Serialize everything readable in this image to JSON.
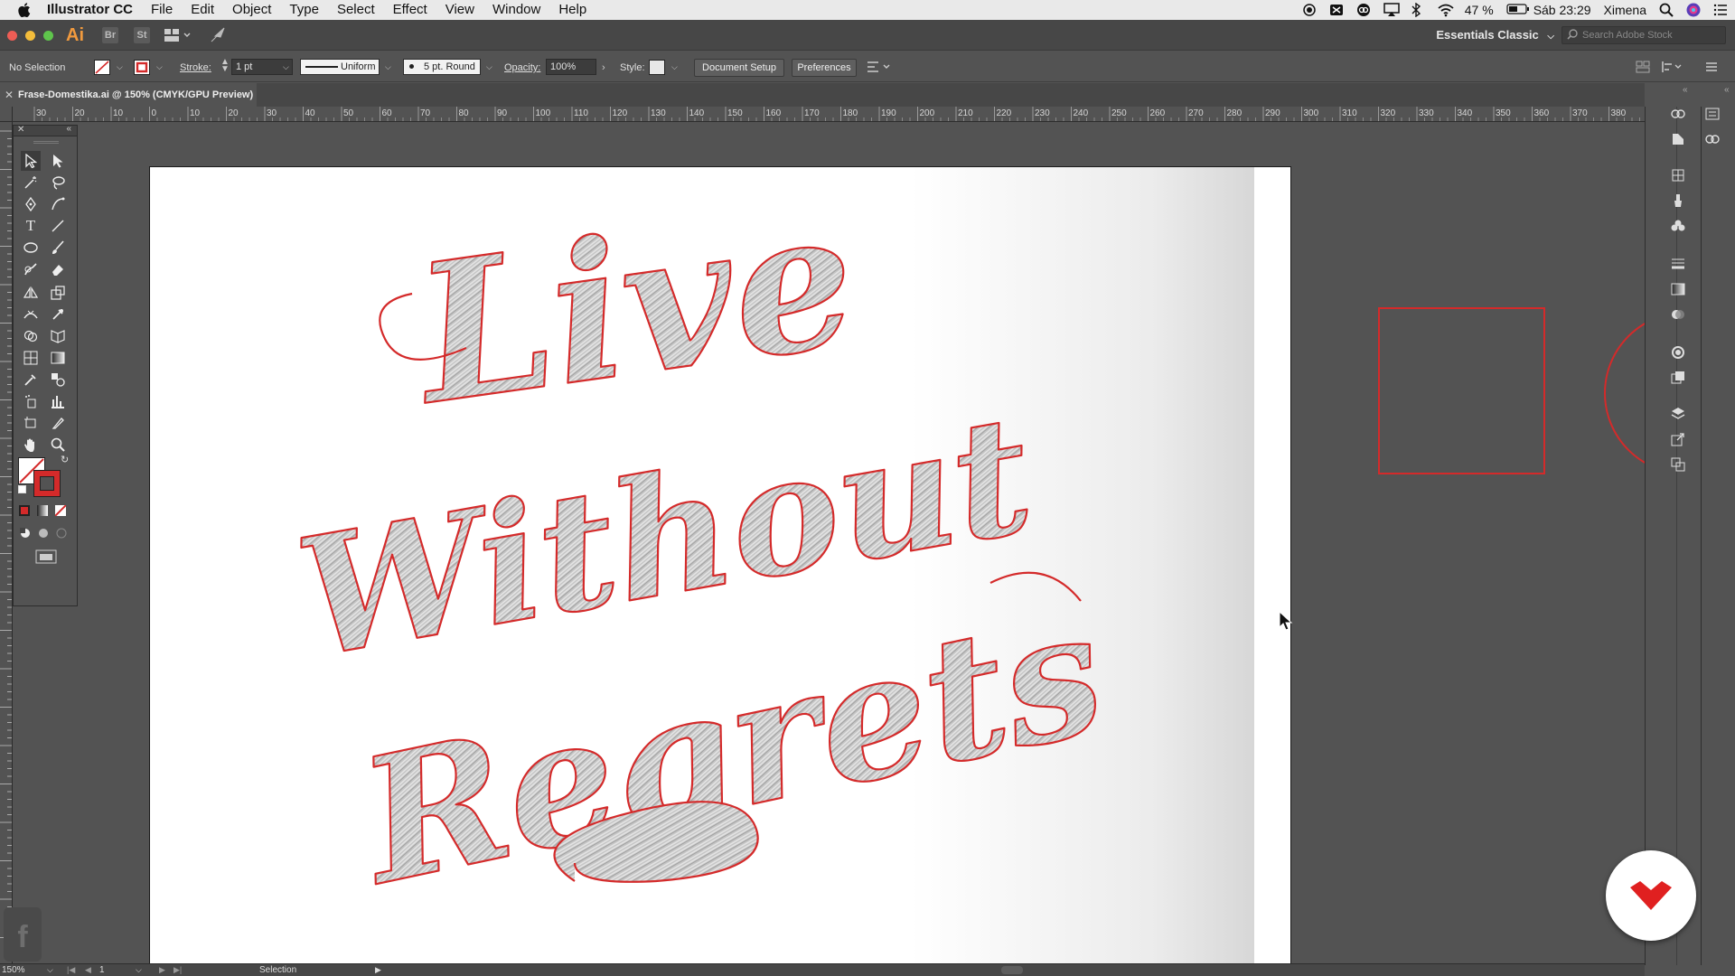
{
  "menubar": {
    "app_name": "Illustrator CC",
    "items": [
      "File",
      "Edit",
      "Object",
      "Type",
      "Select",
      "Effect",
      "View",
      "Window",
      "Help"
    ],
    "battery": "47 %",
    "clock": "Sáb 23:29",
    "user": "Ximena"
  },
  "appbar": {
    "logo": "Ai",
    "bridge": "Br",
    "stock": "St",
    "workspace": "Essentials Classic",
    "search_placeholder": "Search Adobe Stock"
  },
  "controlbar": {
    "selection": "No Selection",
    "stroke_label": "Stroke:",
    "stroke_weight": "1 pt",
    "profile": "Uniform",
    "brush": "5 pt. Round",
    "opacity_label": "Opacity:",
    "opacity_value": "100%",
    "style_label": "Style:",
    "document_setup": "Document Setup",
    "preferences": "Preferences"
  },
  "document": {
    "tab_title": "Frase-Domestika.ai @ 150% (CMYK/GPU Preview)"
  },
  "ruler": {
    "labels": [
      "30",
      "20",
      "10",
      "0",
      "10",
      "20",
      "30",
      "40",
      "50",
      "60",
      "70",
      "80",
      "90",
      "100",
      "110",
      "120",
      "130",
      "140",
      "150",
      "160",
      "170",
      "180",
      "190",
      "200",
      "210",
      "220",
      "230",
      "240",
      "250",
      "260",
      "270",
      "280",
      "290",
      "300",
      "310",
      "320",
      "330",
      "340",
      "350",
      "360",
      "370",
      "380"
    ]
  },
  "artwork": {
    "line1": "Live",
    "line2": "Without",
    "line3": "Regrets",
    "outline_color": "#d42a2a",
    "fill_color": "#bdbdbd"
  },
  "statusbar": {
    "zoom": "150%",
    "artboard_number": "1",
    "tool": "Selection"
  },
  "colors": {
    "accent_red": "#d42a2a",
    "ui_dark": "#535353",
    "brand_red": "#e02020"
  }
}
